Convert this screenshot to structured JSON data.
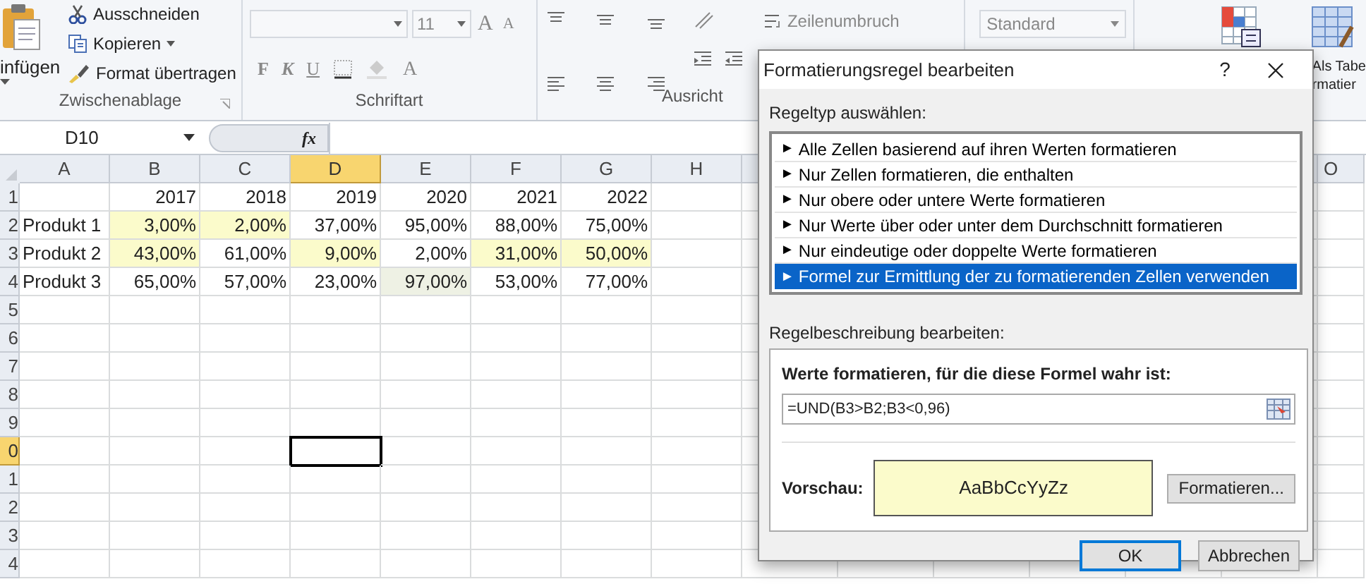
{
  "ribbon": {
    "clipboard": {
      "paste_label": "infügen",
      "cut": "Ausschneiden",
      "copy": "Kopieren",
      "format_painter": "Format übertragen",
      "group_label": "Zwischenablage"
    },
    "font": {
      "size": "11",
      "bold": "F",
      "italic": "K",
      "underline": "U",
      "font_color": "A",
      "grow": "A",
      "shrink": "A",
      "group_label": "Schriftart"
    },
    "alignment": {
      "wrap_text": "Zeilenumbruch",
      "group_label": "Ausricht"
    },
    "number": {
      "format": "Standard"
    },
    "styles": {
      "table_format_line1": "Als Tabe",
      "table_format_line2": "rmatier"
    }
  },
  "formula_bar": {
    "name_box": "D10",
    "function_label": "fx"
  },
  "sheet": {
    "columns": [
      {
        "label": "A",
        "selected": false
      },
      {
        "label": "B",
        "selected": false
      },
      {
        "label": "C",
        "selected": false
      },
      {
        "label": "D",
        "selected": true
      },
      {
        "label": "E",
        "selected": false
      },
      {
        "label": "F",
        "selected": false
      },
      {
        "label": "G",
        "selected": false
      },
      {
        "label": "H",
        "selected": false
      }
    ],
    "right_column": "O",
    "rows": [
      {
        "header": "1",
        "selected": false,
        "values": [
          {
            "text": "2017"
          },
          {
            "text": "2018"
          },
          {
            "text": "2019"
          },
          {
            "text": "2020"
          },
          {
            "text": "2021"
          },
          {
            "text": "2022"
          }
        ]
      },
      {
        "header": "2",
        "selected": false,
        "label": "Produkt 1",
        "values": [
          {
            "text": "3,00%",
            "color": "#fbfbcb"
          },
          {
            "text": "2,00%",
            "color": "#fbfbcb"
          },
          {
            "text": "37,00%"
          },
          {
            "text": "95,00%"
          },
          {
            "text": "88,00%"
          },
          {
            "text": "75,00%"
          }
        ]
      },
      {
        "header": "3",
        "selected": false,
        "label": "Produkt 2",
        "values": [
          {
            "text": "43,00%",
            "color": "#fbfbcb"
          },
          {
            "text": "61,00%"
          },
          {
            "text": "9,00%",
            "color": "#fbfbcb"
          },
          {
            "text": "2,00%"
          },
          {
            "text": "31,00%",
            "color": "#fbfbcb"
          },
          {
            "text": "50,00%",
            "color": "#fbfbcb"
          }
        ]
      },
      {
        "header": "4",
        "selected": false,
        "label": "Produkt 3",
        "values": [
          {
            "text": "65,00%"
          },
          {
            "text": "57,00%"
          },
          {
            "text": "23,00%"
          },
          {
            "text": "97,00%",
            "color": "#eef1e4"
          },
          {
            "text": "53,00%"
          },
          {
            "text": "77,00%"
          }
        ]
      },
      {
        "header": "5",
        "selected": false
      },
      {
        "header": "6",
        "selected": false
      },
      {
        "header": "7",
        "selected": false
      },
      {
        "header": "8",
        "selected": false
      },
      {
        "header": "9",
        "selected": false
      },
      {
        "header": "0",
        "selected": true
      },
      {
        "header": "1",
        "selected": false
      },
      {
        "header": "2",
        "selected": false
      },
      {
        "header": "3",
        "selected": false
      },
      {
        "header": "4",
        "selected": false
      }
    ]
  },
  "dialog": {
    "title": "Formatierungsregel bearbeiten",
    "help": "?",
    "rule_type_label": "Regeltyp auswählen:",
    "rule_types": [
      {
        "marker": "►",
        "label": "Alle Zellen basierend auf ihren Werten formatieren",
        "selected": false
      },
      {
        "marker": "►",
        "label": "Nur Zellen formatieren, die enthalten",
        "selected": false
      },
      {
        "marker": "►",
        "label": "Nur obere oder untere Werte formatieren",
        "selected": false
      },
      {
        "marker": "►",
        "label": "Nur Werte über oder unter dem Durchschnitt formatieren",
        "selected": false
      },
      {
        "marker": "►",
        "label": "Nur eindeutige oder doppelte Werte formatieren",
        "selected": false
      },
      {
        "marker": "►",
        "label": "Formel zur Ermittlung der zu formatierenden Zellen verwenden",
        "selected": true
      }
    ],
    "description_label": "Regelbeschreibung bearbeiten:",
    "formula_label": "Werte formatieren, für die diese Formel wahr ist:",
    "formula": "=UND(B3>B2;B3<0,96)",
    "preview_label": "Vorschau:",
    "preview_text": "AaBbCcYyZz",
    "format_button": "Formatieren...",
    "ok_button": "OK",
    "cancel_button": "Abbrechen"
  }
}
